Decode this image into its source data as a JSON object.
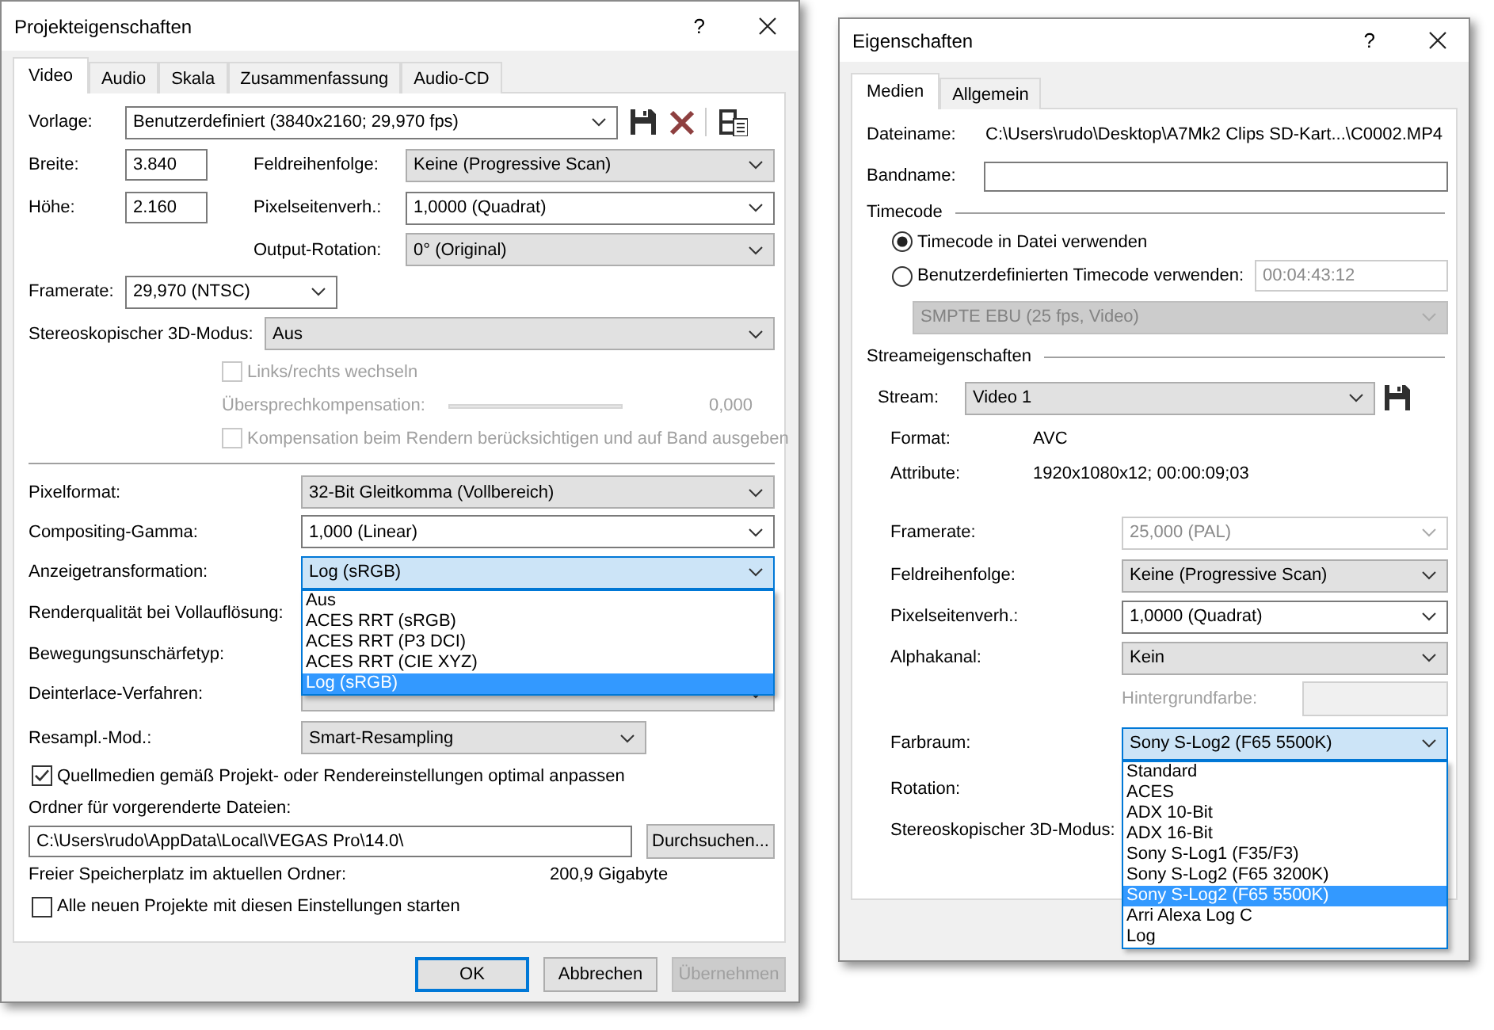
{
  "project_dialog": {
    "title": "Projekteigenschaften",
    "help": "?",
    "tabs": [
      {
        "label": "Video",
        "selected": true
      },
      {
        "label": "Audio",
        "selected": false
      },
      {
        "label": "Skala",
        "selected": false
      },
      {
        "label": "Zusammenfassung",
        "selected": false
      },
      {
        "label": "Audio-CD",
        "selected": false
      }
    ],
    "preset": {
      "label": "Vorlage:",
      "value": "Benutzerdefiniert (3840x2160; 29,970 fps)",
      "kind": "edit"
    },
    "width": {
      "label": "Breite:",
      "value": "3.840"
    },
    "height": {
      "label": "Höhe:",
      "value": "2.160"
    },
    "field_order": {
      "label": "Feldreihenfolge:",
      "value": "Keine (Progressive Scan)",
      "kind": "list"
    },
    "pixel_aspect": {
      "label": "Pixelseitenverh.:",
      "value": "1,0000 (Quadrat)",
      "kind": "edit"
    },
    "output_rotation": {
      "label": "Output-Rotation:",
      "value": "0° (Original)",
      "kind": "list"
    },
    "framerate": {
      "label": "Framerate:",
      "value": "29,970 (NTSC)",
      "kind": "edit"
    },
    "stereo_mode": {
      "label": "Stereoskopischer 3D-Modus:",
      "value": "Aus",
      "kind": "list"
    },
    "swap_checkbox": {
      "label": "Links/rechts wechseln",
      "checked": false,
      "disabled": true
    },
    "crosstalk": {
      "label": "Übersprechkompensation:",
      "reading": "0,000",
      "disabled": true
    },
    "render_comp_checkbox": {
      "label": "Kompensation beim Rendern berücksichtigen und auf Band ausgeben",
      "checked": false,
      "disabled": true
    },
    "lower_rows": [
      {
        "label": "Pixelformat:",
        "value": "32-Bit Gleitkomma (Vollbereich)",
        "kind": "list"
      },
      {
        "label": "Compositing-Gamma:",
        "value": "1,000 (Linear)",
        "kind": "edit"
      },
      {
        "label": "Anzeigetransformation:",
        "value": "Log (sRGB)",
        "kind": "edit",
        "focused": true,
        "options": [
          {
            "label": "Aus",
            "selected": false
          },
          {
            "label": "ACES RRT (sRGB)",
            "selected": false
          },
          {
            "label": "ACES RRT (P3 DCI)",
            "selected": false
          },
          {
            "label": "ACES RRT (CIE XYZ)",
            "selected": false
          },
          {
            "label": "Log (sRGB)",
            "selected": true
          }
        ]
      },
      {
        "label": "Renderqualität bei Vollauflösung:"
      },
      {
        "label": "Bewegungsunschärfetyp:"
      },
      {
        "label": "Deinterlace-Verfahren:",
        "kind": "list"
      },
      {
        "label": "Resampl.-Mod.:",
        "value": "Smart-Resampling",
        "kind": "list"
      }
    ],
    "adapt_checkbox": {
      "label": "Quellmedien gemäß Projekt- oder Rendereinstellungen optimal anpassen",
      "checked": true
    },
    "folder": {
      "label": "Ordner für vorgerenderte Dateien:",
      "value": "C:\\Users\\rudo\\AppData\\Local\\VEGAS Pro\\14.0\\",
      "browse": "Durchsuchen..."
    },
    "free_space": {
      "label": "Freier Speicherplatz im aktuellen Ordner:",
      "value": "200,9 Gigabyte"
    },
    "startup_checkbox": {
      "label": "Alle neuen Projekte mit diesen Einstellungen starten",
      "checked": false
    },
    "buttons": [
      {
        "label": "OK",
        "focused": true,
        "disabled": false
      },
      {
        "label": "Abbrechen",
        "focused": false,
        "disabled": false
      },
      {
        "label": "Übernehmen",
        "focused": false,
        "disabled": true
      }
    ]
  },
  "properties_dialog": {
    "title": "Eigenschaften",
    "help": "?",
    "tabs": [
      {
        "label": "Medien",
        "selected": true
      },
      {
        "label": "Allgemein",
        "selected": false
      }
    ],
    "file_name": {
      "label": "Dateiname:",
      "value": "C:\\Users\\rudo\\Desktop\\A7Mk2 Clips SD-Kart...\\C0002.MP4"
    },
    "tape_name": {
      "label": "Bandname:"
    },
    "timecode": {
      "heading": "Timecode",
      "options": [
        {
          "label": "Timecode in Datei verwenden",
          "selected": true
        },
        {
          "label": "Benutzerdefinierten Timecode verwenden:",
          "selected": false
        }
      ],
      "custom_value": "00:04:43:12",
      "format": {
        "value": "SMPTE EBU (25 fps, Video)",
        "kind": "list",
        "disabled": true
      }
    },
    "stream_props": {
      "heading": "Streameigenschaften",
      "stream": {
        "label": "Stream:",
        "value": "Video 1",
        "kind": "list"
      },
      "info": [
        {
          "label": "Format:",
          "value": "AVC"
        },
        {
          "label": "Attribute:",
          "value": "1920x1080x12; 00:00:09;03"
        }
      ],
      "rows": [
        {
          "label": "Framerate:",
          "value": "25,000 (PAL)",
          "kind": "edit",
          "disabled": true
        },
        {
          "label": "Feldreihenfolge:",
          "value": "Keine (Progressive Scan)",
          "kind": "list"
        },
        {
          "label": "Pixelseitenverh.:",
          "value": "1,0000 (Quadrat)",
          "kind": "edit"
        },
        {
          "label": "Alphakanal:",
          "value": "Kein",
          "kind": "list"
        },
        {
          "label": "Hintergrundfarbe:",
          "kind": "color",
          "disabled": true
        },
        {
          "label": "Farbraum:",
          "value": "Sony S-Log2 (F65 5500K)",
          "kind": "edit",
          "focused": true,
          "options": [
            {
              "label": "Standard",
              "selected": false
            },
            {
              "label": "ACES",
              "selected": false
            },
            {
              "label": "ADX 10-Bit",
              "selected": false
            },
            {
              "label": "ADX 16-Bit",
              "selected": false
            },
            {
              "label": "Sony S-Log1 (F35/F3)",
              "selected": false
            },
            {
              "label": "Sony S-Log2 (F65 3200K)",
              "selected": false
            },
            {
              "label": "Sony S-Log2 (F65 5500K)",
              "selected": true
            },
            {
              "label": "Arri Alexa Log C",
              "selected": false
            },
            {
              "label": "Log",
              "selected": false
            }
          ]
        },
        {
          "label": "Rotation:"
        },
        {
          "label": "Stereoskopischer 3D-Modus:"
        }
      ]
    }
  }
}
